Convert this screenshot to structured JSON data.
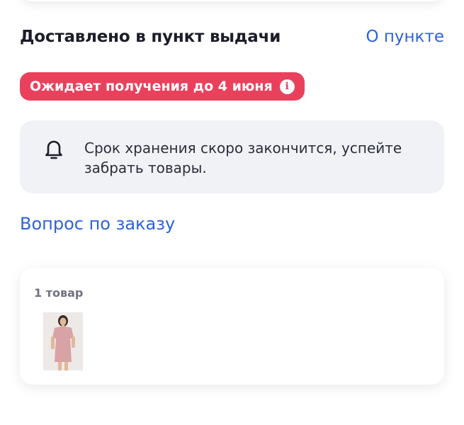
{
  "order": {
    "status_title": "Доставлено в пункт выдачи",
    "about_link": "О пункте",
    "badge_text": "Ожидает получения до 4 июня",
    "badge_color": "#e9415c",
    "notice_text": "Срок хранения скоро закончится, успейте забрать товары.",
    "question_link": "Вопрос по заказу",
    "items_count": "1 товар",
    "accent_color": "#2f62d8"
  },
  "icons": {
    "badge_icon": "info-icon",
    "notice_icon": "bell-icon"
  }
}
